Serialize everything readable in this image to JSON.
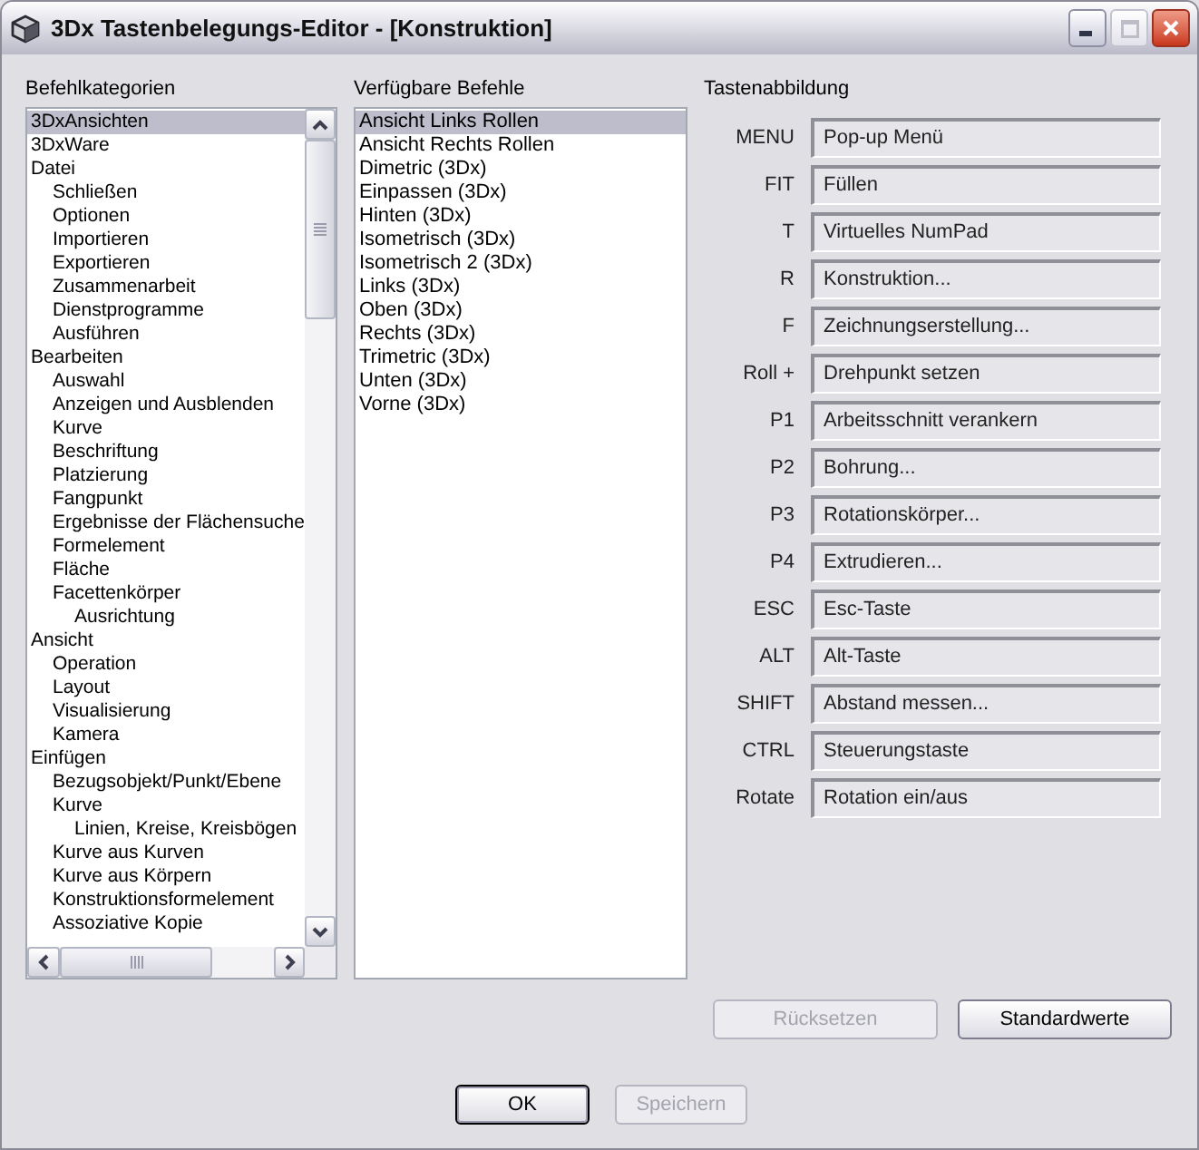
{
  "window": {
    "title": "3Dx Tastenbelegungs-Editor - [Konstruktion]",
    "controls": [
      {
        "kind": "minimize",
        "disabled": false
      },
      {
        "kind": "maximize",
        "disabled": true
      },
      {
        "kind": "close",
        "disabled": false
      }
    ]
  },
  "categories": {
    "label": "Befehlkategorien",
    "items": [
      {
        "label": "3DxAnsichten",
        "selected": true
      },
      {
        "label": "3DxWare",
        "selected": false
      },
      {
        "label": "Datei",
        "selected": false,
        "children": [
          {
            "label": "Schließen",
            "selected": false
          },
          {
            "label": "Optionen",
            "selected": false
          },
          {
            "label": "Importieren",
            "selected": false
          },
          {
            "label": "Exportieren",
            "selected": false
          },
          {
            "label": "Zusammenarbeit",
            "selected": false
          },
          {
            "label": "Dienstprogramme",
            "selected": false
          },
          {
            "label": "Ausführen",
            "selected": false
          }
        ]
      },
      {
        "label": "Bearbeiten",
        "selected": false,
        "children": [
          {
            "label": "Auswahl",
            "selected": false
          },
          {
            "label": "Anzeigen und Ausblenden",
            "selected": false
          },
          {
            "label": "Kurve",
            "selected": false
          },
          {
            "label": "Beschriftung",
            "selected": false
          },
          {
            "label": "Platzierung",
            "selected": false
          },
          {
            "label": "Fangpunkt",
            "selected": false
          },
          {
            "label": "Ergebnisse der Flächensuche",
            "selected": false
          },
          {
            "label": "Formelement",
            "selected": false
          },
          {
            "label": "Fläche",
            "selected": false
          },
          {
            "label": "Facettenkörper",
            "selected": false,
            "children": [
              {
                "label": "Ausrichtung",
                "selected": false
              }
            ]
          }
        ]
      },
      {
        "label": "Ansicht",
        "selected": false,
        "children": [
          {
            "label": "Operation",
            "selected": false
          },
          {
            "label": "Layout",
            "selected": false
          },
          {
            "label": "Visualisierung",
            "selected": false
          },
          {
            "label": "Kamera",
            "selected": false
          }
        ]
      },
      {
        "label": "Einfügen",
        "selected": false,
        "children": [
          {
            "label": "Bezugsobjekt/Punkt/Ebene",
            "selected": false
          },
          {
            "label": "Kurve",
            "selected": false,
            "children": [
              {
                "label": "Linien, Kreise, Kreisbögen",
                "selected": false
              }
            ]
          },
          {
            "label": "Kurve aus Kurven",
            "selected": false
          },
          {
            "label": "Kurve aus Körpern",
            "selected": false
          },
          {
            "label": "Konstruktionsformelement",
            "selected": false
          },
          {
            "label": "Assoziative Kopie",
            "selected": false
          }
        ]
      }
    ]
  },
  "commands": {
    "label": "Verfügbare Befehle",
    "items": [
      {
        "label": "Ansicht Links Rollen",
        "selected": true
      },
      {
        "label": "Ansicht Rechts Rollen",
        "selected": false
      },
      {
        "label": "Dimetric (3Dx)",
        "selected": false
      },
      {
        "label": "Einpassen (3Dx)",
        "selected": false
      },
      {
        "label": "Hinten (3Dx)",
        "selected": false
      },
      {
        "label": "Isometrisch (3Dx)",
        "selected": false
      },
      {
        "label": "Isometrisch 2 (3Dx)",
        "selected": false
      },
      {
        "label": "Links (3Dx)",
        "selected": false
      },
      {
        "label": "Oben (3Dx)",
        "selected": false
      },
      {
        "label": "Rechts (3Dx)",
        "selected": false
      },
      {
        "label": "Trimetric (3Dx)",
        "selected": false
      },
      {
        "label": "Unten (3Dx)",
        "selected": false
      },
      {
        "label": "Vorne (3Dx)",
        "selected": false
      }
    ]
  },
  "mapping": {
    "label": "Tastenabbildung",
    "rows": [
      {
        "key": "MENU",
        "command": "Pop-up Menü"
      },
      {
        "key": "FIT",
        "command": "Füllen"
      },
      {
        "key": "T",
        "command": "Virtuelles NumPad"
      },
      {
        "key": "R",
        "command": "Konstruktion..."
      },
      {
        "key": "F",
        "command": "Zeichnungserstellung..."
      },
      {
        "key": "Roll +",
        "command": "Drehpunkt setzen"
      },
      {
        "key": "P1",
        "command": "Arbeitsschnitt verankern"
      },
      {
        "key": "P2",
        "command": "Bohrung..."
      },
      {
        "key": "P3",
        "command": "Rotationskörper..."
      },
      {
        "key": "P4",
        "command": "Extrudieren..."
      },
      {
        "key": "ESC",
        "command": "Esc-Taste"
      },
      {
        "key": "ALT",
        "command": "Alt-Taste"
      },
      {
        "key": "SHIFT",
        "command": "Abstand messen..."
      },
      {
        "key": "CTRL",
        "command": "Steuerungstaste"
      },
      {
        "key": "Rotate",
        "command": "Rotation ein/aus"
      }
    ]
  },
  "actions": [
    {
      "label": "Rücksetzen",
      "disabled": true
    },
    {
      "label": "Standardwerte",
      "disabled": false
    }
  ],
  "dialog_buttons": [
    {
      "label": "OK",
      "disabled": false,
      "default": true
    },
    {
      "label": "Speichern",
      "disabled": true,
      "default": false
    }
  ]
}
